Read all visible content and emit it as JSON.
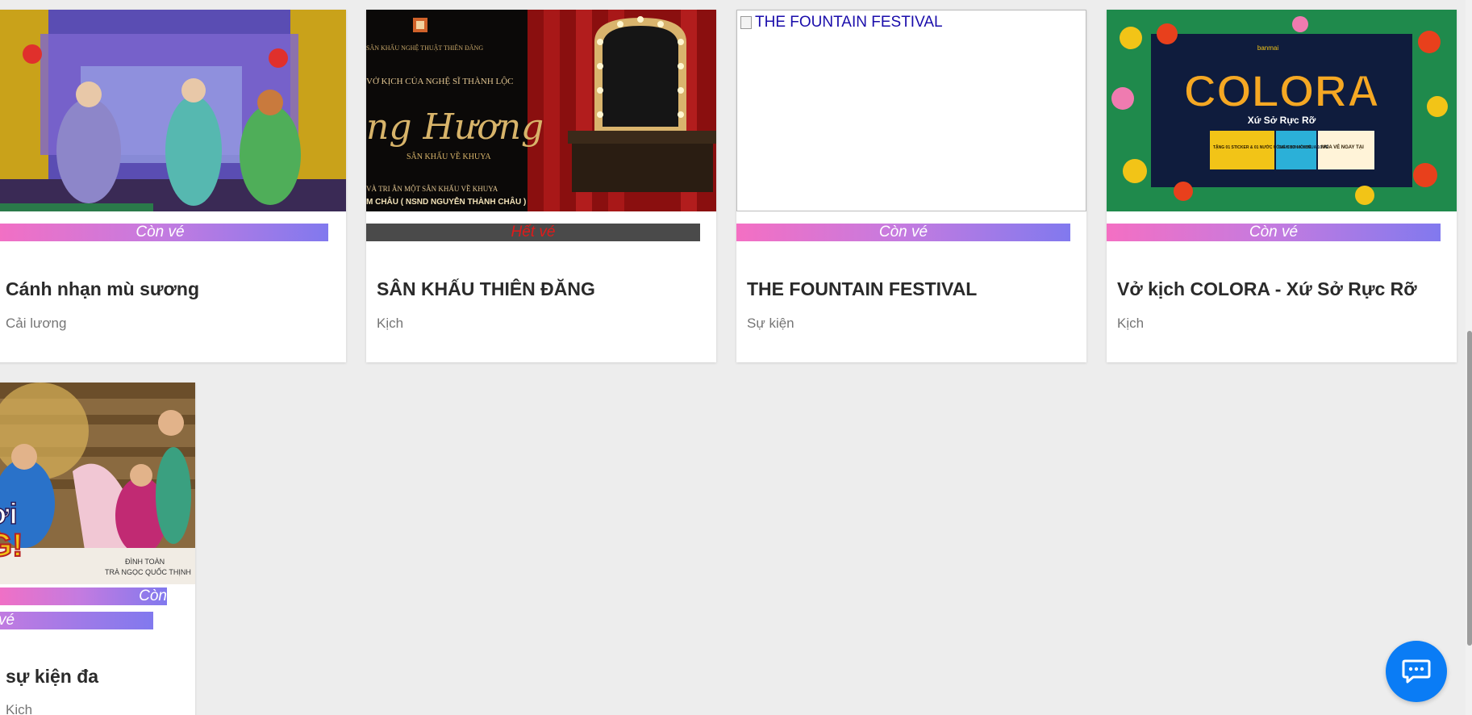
{
  "cards": [
    {
      "title": "Cánh nhạn mù sương",
      "category": "Cải lương",
      "status": "Còn vé"
    },
    {
      "title": "SÂN KHẤU THIÊN ĐĂNG",
      "category": "Kịch",
      "status": "Hết vé",
      "poster_text": {
        "top": "SÂN KHẤU NGHỆ THUẬT THIÊN ĐĂNG",
        "line1": "VỞ KỊCH CỦA NGHỆ SĨ THÀNH LỘC",
        "script_title": "ng Hương",
        "script_sub": "SÂN KHẤU VỀ KHUYA",
        "bottom1": "VÀ TRI ÂN MỘT   SÂN KHẤU VỀ KHUYA",
        "bottom2": "M CHÂU ( NSND NGUYỄN THÀNH CHÂU )"
      }
    },
    {
      "title": "THE FOUNTAIN FESTIVAL",
      "category": "Sự kiện",
      "status": "Còn vé",
      "image_alt": "THE FOUNTAIN FESTIVAL"
    },
    {
      "title": "Vở kịch COLORA - Xứ Sở Rực Rỡ",
      "category": "Kịch",
      "status": "Còn vé",
      "poster_text": {
        "brand": "banmai",
        "logo": "COLORA",
        "tagline": "Xứ Sở Rực Rỡ",
        "box1": "TẶNG 01 STICKER & 01 NƯỚC UỐNG CHO MỖI BÉ",
        "box2": "GIẢM 10% KHI MUA 10 VÉ",
        "box3": "MUA VÉ NGAY TẠI"
      }
    },
    {
      "title": "sự kiện đa",
      "category": "Kịch",
      "status_line1": "Còn",
      "status_line2": "vé",
      "poster_text": {
        "big1": "ơi",
        "big2": "G!",
        "names1": "ĐÌNH TOÀN",
        "names2": "TRÀ NGỌC   QUỐC THỊNH"
      }
    }
  ],
  "colors": {
    "badge_available_gradient": [
      "#f46fc3",
      "#c47be0",
      "#8179ee"
    ],
    "badge_soldout_bg": "#4a4a4a",
    "badge_soldout_text": "#e01a1a",
    "chat_button": "#0a7cf5",
    "page_bg": "#ededed"
  },
  "chat_button": {
    "icon": "chat-bubble-icon"
  }
}
